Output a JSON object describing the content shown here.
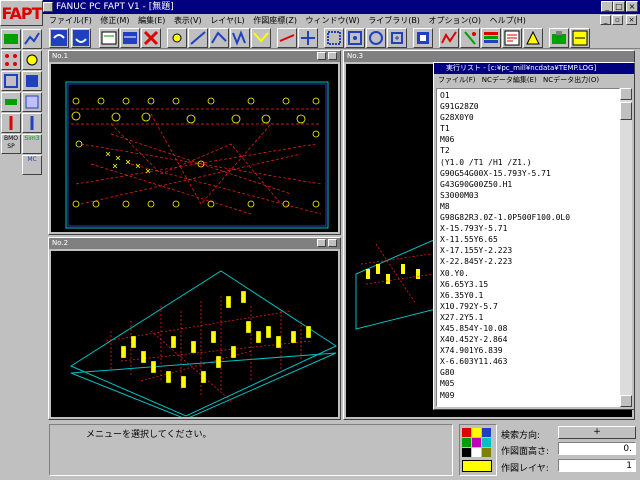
{
  "app": {
    "title": "FANUC PC FAPT V1 - [無題]",
    "logo": "FAPT"
  },
  "menubar": {
    "items": [
      "ファイル(F)",
      "修正(M)",
      "編集(E)",
      "表示(V)",
      "レイヤ(L)",
      "作図座標(Z)",
      "ウィンドウ(W)",
      "ライブラリ(B)",
      "オプション(O)",
      "ヘルプ(H)"
    ]
  },
  "left_tools": {
    "labels": [
      "BMO SP",
      "Sim3",
      "MC"
    ]
  },
  "windows": {
    "no1": "No.1",
    "no2": "No.2",
    "no3": "No.3"
  },
  "list_window": {
    "title": "実行リスト - [c:¥pc_mill¥ncdata¥TEMP.LOG]",
    "menu": [
      "ファイル(F)",
      "NCデータ編集(E)",
      "NCデータ出力(O)"
    ],
    "lines": [
      "O1",
      "G91G28Z0",
      "G28X0Y0",
      "T1",
      "M06",
      "T2",
      "(Y1.0 /T1 /H1 /Z1.)",
      "G90G54G00X-15.793Y-5.71",
      "G43G90G00Z50.H1",
      "S3000M03",
      "M8",
      "G98G82R3.0Z-1.0P500F100.0L0",
      "X-15.793Y-5.71",
      "X-11.55Y6.65",
      "X-17.155Y-2.223",
      "X-22.845Y-2.223",
      "X0.Y0.",
      "X6.65Y3.15",
      "X6.35Y0.1",
      "X10.792Y-5.7",
      "X27.2Y5.1",
      "X45.854Y-10.08",
      "X40.452Y-2.864",
      "X74.901Y6.839",
      "X-6.603Y11.463",
      "G80",
      "M05",
      "M09"
    ]
  },
  "status": {
    "message": "メニューを選択してください。",
    "search_label": "検索方向:",
    "search_value": "+",
    "height_label": "作図面高さ:",
    "height_value": "0.",
    "layer_label": "作図レイヤ:",
    "layer_value": "1"
  },
  "colors": {
    "title_active": "#000080",
    "title_inactive": "#808080",
    "drill_yellow": "#ffff00",
    "path_red": "#ff2020",
    "outline_cyan": "#00c0c0"
  }
}
